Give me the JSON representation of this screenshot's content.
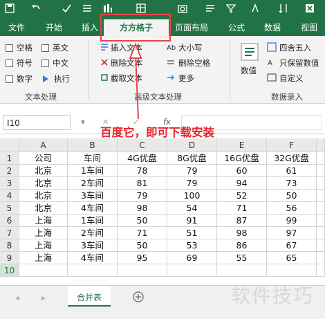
{
  "tabs": [
    "文件",
    "开始",
    "插入",
    "方方格子",
    "页面布局",
    "公式",
    "数据",
    "视图"
  ],
  "ribbon": {
    "text_group": {
      "checkboxes": [
        "空格",
        "英文",
        "符号",
        "中文",
        "数字"
      ],
      "execute": "执行",
      "label": "文本处理"
    },
    "advanced_group": {
      "buttons": [
        "插入文本",
        "删除文本",
        "截取文本"
      ],
      "buttons2": [
        "大小写",
        "删除空格",
        "更多"
      ],
      "label": "高级文本处理"
    },
    "numeric_group": {
      "value_button": "数值",
      "buttons": [
        "四舍五入",
        "只保留数值",
        "自定义"
      ],
      "label": "数据录入"
    }
  },
  "formula_bar": {
    "name_box": "I10",
    "fx": "fx"
  },
  "sheet": {
    "columns": [
      "A",
      "B",
      "C",
      "D",
      "E",
      "F"
    ],
    "rows": [
      [
        "公司",
        "车间",
        "4G优盘",
        "8G优盘",
        "16G优盘",
        "32G优盘"
      ],
      [
        "北京",
        "1车间",
        "78",
        "79",
        "60",
        "61"
      ],
      [
        "北京",
        "2车间",
        "81",
        "79",
        "94",
        "73"
      ],
      [
        "北京",
        "3车间",
        "79",
        "100",
        "52",
        "50"
      ],
      [
        "北京",
        "4车间",
        "98",
        "54",
        "71",
        "56"
      ],
      [
        "上海",
        "1车间",
        "50",
        "91",
        "87",
        "99"
      ],
      [
        "上海",
        "2车间",
        "71",
        "51",
        "98",
        "97"
      ],
      [
        "上海",
        "3车间",
        "50",
        "53",
        "86",
        "67"
      ],
      [
        "上海",
        "4车间",
        "95",
        "69",
        "55",
        "65"
      ],
      [
        "",
        "",
        "",
        "",
        "",
        ""
      ]
    ],
    "row_numbers": [
      "1",
      "2",
      "3",
      "4",
      "5",
      "6",
      "7",
      "8",
      "9",
      "10"
    ]
  },
  "sheet_tab": "合并表",
  "annotation": "百度它，即可下载安装",
  "watermark": "软件技巧",
  "colors": {
    "excel_green": "#217346",
    "annotation_red": "#e8252b"
  }
}
